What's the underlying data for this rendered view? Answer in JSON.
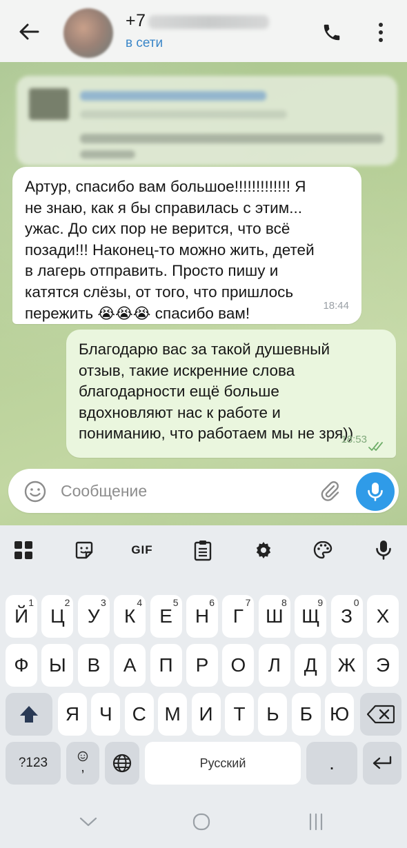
{
  "header": {
    "back_icon": "arrow-left-icon",
    "contact_name": "+7",
    "contact_status": "в сети",
    "call_icon": "phone-icon",
    "menu_icon": "more-vertical-icon"
  },
  "chat": {
    "messages": [
      {
        "direction": "incoming",
        "text": "Артур, спасибо вам большое!!!!!!!!!!!!! Я\nне знаю, как я бы справилась с этим...\nужас. До сих пор не верится, что всё\nпозади!!! Наконец-то можно жить, детей\nв лагерь отправить. Просто пишу и\nкатятся слёзы, от того, что пришлось\nпережить",
        "emoji": "😭😭😭",
        "text_tail": " спасибо вам!",
        "time": "18:44"
      },
      {
        "direction": "outgoing",
        "text": "Благодарю вас за такой душевный\nотзыв, такие искренние слова\nблагодарности ещё больше\nвдохновляют нас к работе и\nпониманию, что работаем мы не зря))",
        "time": "18:53",
        "status_icon": "double-check-icon"
      }
    ]
  },
  "input": {
    "placeholder": "Сообщение",
    "emoji_icon": "smiley-icon",
    "attach_icon": "paperclip-icon",
    "mic_icon": "microphone-icon"
  },
  "keyboard": {
    "toolbar": [
      "apps-grid-icon",
      "sticker-icon",
      "GIF",
      "clipboard-icon",
      "settings-gear-icon",
      "palette-icon",
      "microphone-icon"
    ],
    "gif_label": "GIF",
    "row1": [
      {
        "k": "й",
        "h": "1"
      },
      {
        "k": "ц",
        "h": "2"
      },
      {
        "k": "у",
        "h": "3"
      },
      {
        "k": "к",
        "h": "4"
      },
      {
        "k": "е",
        "h": "5"
      },
      {
        "k": "н",
        "h": "6"
      },
      {
        "k": "г",
        "h": "7"
      },
      {
        "k": "ш",
        "h": "8"
      },
      {
        "k": "щ",
        "h": "9"
      },
      {
        "k": "з",
        "h": "0"
      },
      {
        "k": "х",
        "h": ""
      }
    ],
    "row2": [
      "ф",
      "ы",
      "в",
      "а",
      "п",
      "р",
      "о",
      "л",
      "д",
      "ж",
      "э"
    ],
    "row3": [
      "я",
      "ч",
      "с",
      "м",
      "и",
      "т",
      "ь",
      "б",
      "ю"
    ],
    "symbols_label": "?123",
    "comma_label": ",",
    "space_label": "Русский",
    "period_label": "."
  },
  "navbar": {
    "back_icon": "chevron-down-icon",
    "home_icon": "home-circle-icon",
    "recents_icon": "recents-icon"
  }
}
